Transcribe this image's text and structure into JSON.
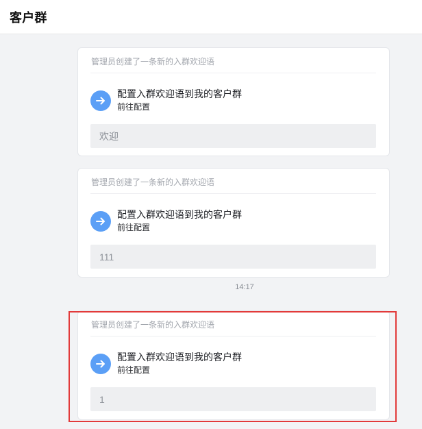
{
  "header": {
    "title": "客户群"
  },
  "cards": [
    {
      "header_text": "管理员创建了一条新的入群欢迎语",
      "action_title": "配置入群欢迎语到我的客户群",
      "action_subtitle": "前往配置",
      "message": "欢迎",
      "icon": "arrow-right-icon"
    },
    {
      "header_text": "管理员创建了一条新的入群欢迎语",
      "action_title": "配置入群欢迎语到我的客户群",
      "action_subtitle": "前往配置",
      "message": "111",
      "icon": "arrow-right-icon"
    },
    {
      "header_text": "管理员创建了一条新的入群欢迎语",
      "action_title": "配置入群欢迎语到我的客户群",
      "action_subtitle": "前往配置",
      "message": "1",
      "icon": "arrow-right-icon"
    }
  ],
  "timestamp": "14:17",
  "colors": {
    "accent": "#5b9ff6",
    "highlight": "#e23a3a"
  }
}
